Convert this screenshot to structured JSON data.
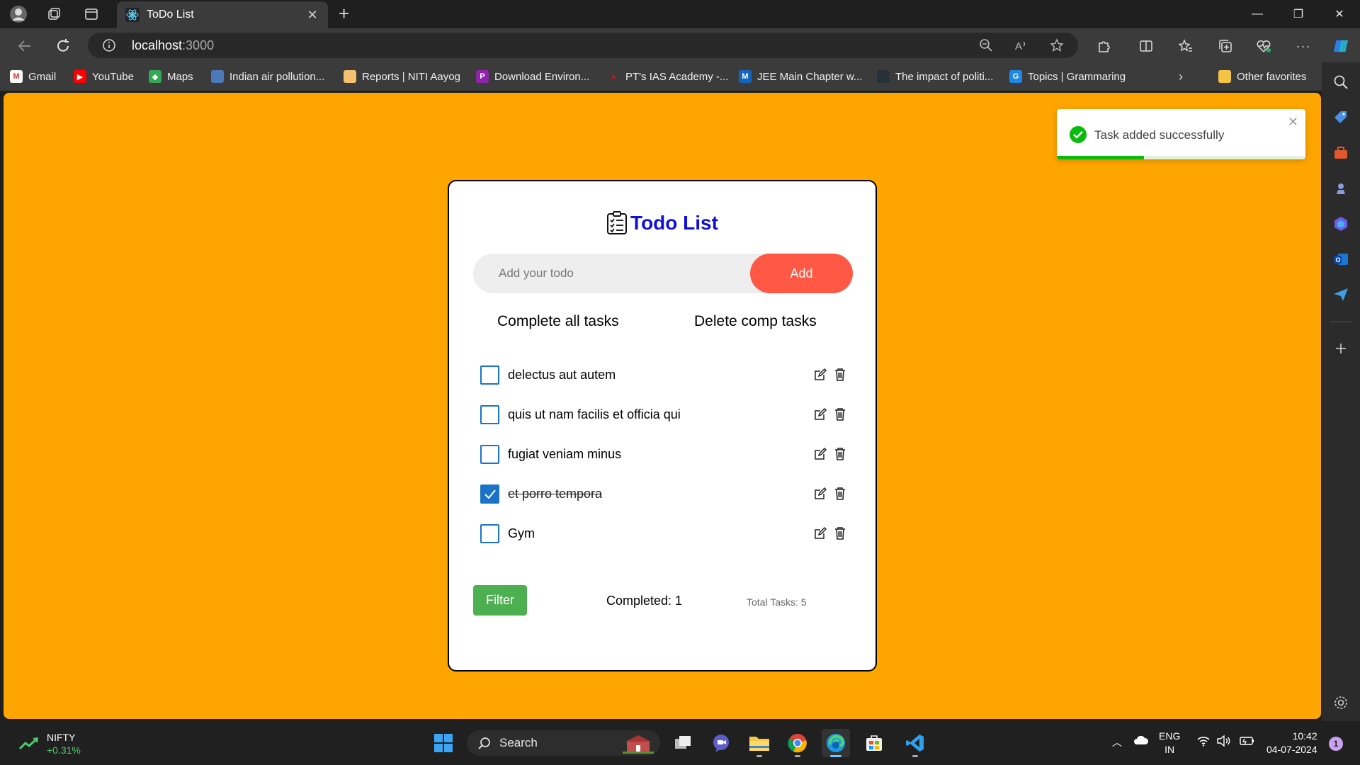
{
  "browser": {
    "tab_title": "ToDo List",
    "url_host": "localhost",
    "url_port": ":3000"
  },
  "favorites": [
    {
      "label": "Gmail",
      "icon": "gmail-icon",
      "color": "#d93025"
    },
    {
      "label": "YouTube",
      "icon": "youtube-icon",
      "color": "#ff0000"
    },
    {
      "label": "Maps",
      "icon": "maps-icon",
      "color": "#34a853"
    },
    {
      "label": "Indian air pollution...",
      "icon": "page-icon",
      "color": "#4a7ab8"
    },
    {
      "label": "Reports | NITI Aayog",
      "icon": "niti-icon",
      "color": "#f5c16c"
    },
    {
      "label": "Download Environ...",
      "icon": "p-icon",
      "color": "#8e24aa"
    },
    {
      "label": "PT's IAS Academy -...",
      "icon": "pt-icon",
      "color": "#b71c1c"
    },
    {
      "label": "JEE Main Chapter w...",
      "icon": "jee-icon",
      "color": "#1565c0"
    },
    {
      "label": "The impact of politi...",
      "icon": "article-icon",
      "color": "#263238"
    },
    {
      "label": "Topics | Grammaring",
      "icon": "g-icon",
      "color": "#1e88e5"
    }
  ],
  "other_favorites": "Other favorites",
  "app": {
    "title": "Todo List",
    "input_placeholder": "Add your todo",
    "add_label": "Add",
    "complete_all_label": "Complete all tasks",
    "delete_completed_label": "Delete comp tasks",
    "tasks": [
      {
        "text": "delectus aut autem",
        "completed": false
      },
      {
        "text": "quis ut nam facilis et officia qui",
        "completed": false
      },
      {
        "text": "fugiat veniam minus",
        "completed": false
      },
      {
        "text": "et porro tempora",
        "completed": true
      },
      {
        "text": "Gym",
        "completed": false
      }
    ],
    "filter_label": "Filter",
    "completed_text": "Completed: 1",
    "total_text": "Total Tasks: 5"
  },
  "toast": {
    "message": "Task added successfully",
    "progress": 0.35
  },
  "taskbar": {
    "ticker_name": "NIFTY",
    "ticker_change": "+0.31%",
    "search_label": "Search",
    "lang_line1": "ENG",
    "lang_line2": "IN",
    "time": "10:42",
    "date": "04-07-2024",
    "notification_count": "1"
  },
  "colors": {
    "page_background": "#ffa500",
    "title": "#1010d8",
    "add_button": "#ff5945",
    "filter_button": "#4caf50",
    "checkbox": "#1a73c7"
  }
}
